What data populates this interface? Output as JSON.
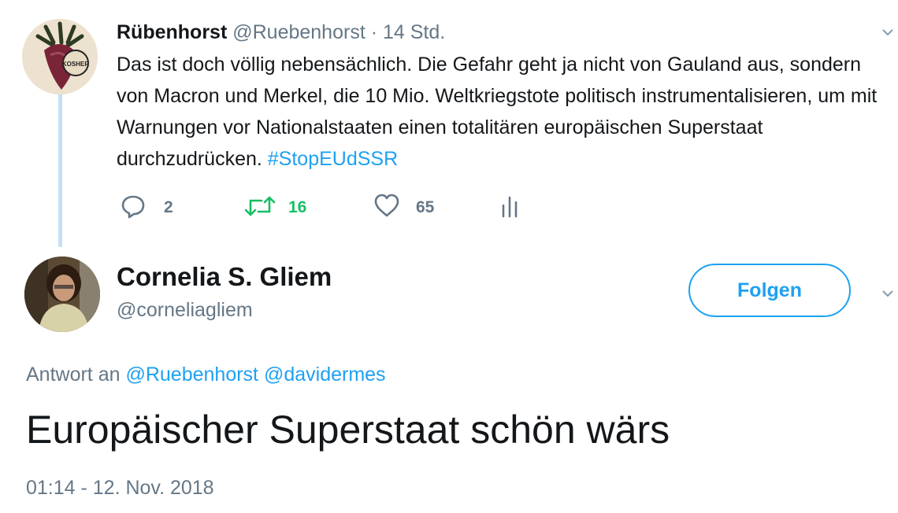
{
  "parent_tweet": {
    "display_name": "Rübenhorst",
    "handle": "@Ruebenhorst",
    "separator": "·",
    "time": "14 Std.",
    "avatar_text": "KOSHER",
    "text": "Das ist doch völlig nebensächlich. Die Gefahr geht ja nicht von Gauland aus, sondern von Macron und Merkel, die 10 Mio. Weltkriegstote politisch instrumentalisieren, um mit Warnungen vor Nationalstaaten einen totalitären europäischen Superstaat durchzudrücken.",
    "hashtag": "#StopEUdSSR",
    "reply_count": "2",
    "retweet_count": "16",
    "like_count": "65"
  },
  "main_tweet": {
    "display_name": "Cornelia S. Gliem",
    "handle": "@corneliagliem",
    "follow_label": "Folgen",
    "reply_prefix": "Antwort an",
    "reply_mentions": [
      "@Ruebenhorst",
      "@davidermes"
    ],
    "text": "Europäischer Superstaat schön wärs",
    "timestamp": "01:14 - 12. Nov. 2018"
  },
  "colors": {
    "accent": "#1da1f2",
    "retweet_green": "#17bf63",
    "secondary_text": "#657786",
    "thread_line": "#c4dff6"
  },
  "icons": {
    "reply": "reply-icon",
    "retweet": "retweet-icon",
    "like": "heart-icon",
    "analytics": "analytics-icon",
    "more": "chevron-down-icon"
  }
}
